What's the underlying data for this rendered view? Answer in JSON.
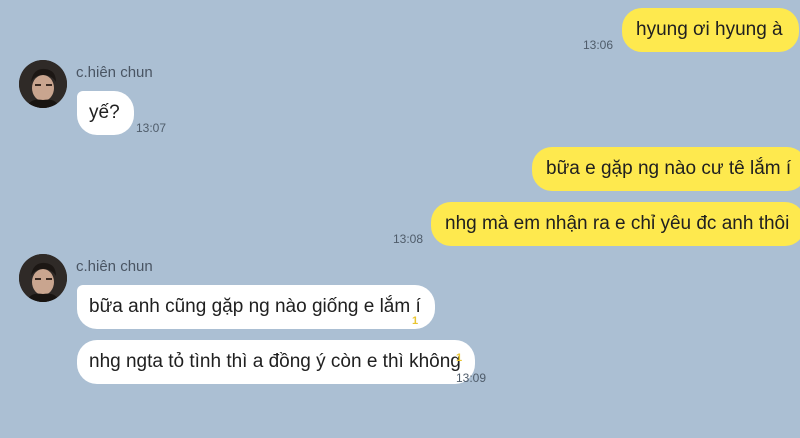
{
  "messages": {
    "m1": {
      "text": "hyung ơi hyung à",
      "time": "13:06"
    },
    "g1": {
      "sender": "c.hiên chun",
      "avatar_icon": "profile-photo",
      "m2": {
        "text": "yế?",
        "time": "13:07"
      }
    },
    "m3": {
      "text": "bữa e gặp ng nào cư tê lắm í"
    },
    "m4": {
      "text": "nhg mà em nhận ra e chỉ yêu đc anh thôi",
      "time": "13:08"
    },
    "g2": {
      "sender": "c.hiên chun",
      "avatar_icon": "profile-photo",
      "m5": {
        "text": "bữa anh cũng gặp ng nào giống e lắm í",
        "unread": "1"
      },
      "m6": {
        "text": "nhg ngta tỏ tình thì a đồng ý còn e thì không",
        "unread": "1",
        "time": "13:09"
      }
    }
  },
  "colors": {
    "background": "#abbfd3",
    "outgoing_bubble": "#fee94e",
    "incoming_bubble": "#ffffff",
    "unread_count": "#e9c530"
  }
}
